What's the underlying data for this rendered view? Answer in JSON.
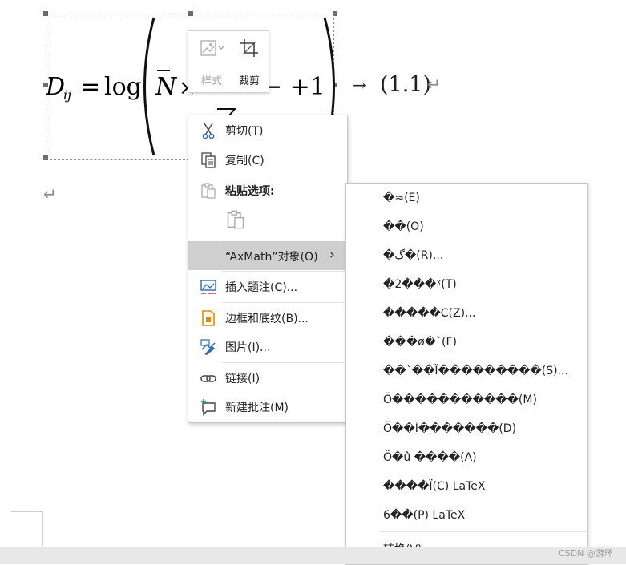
{
  "document": {
    "equation_number": "(1.1)",
    "arrow": "→",
    "paragraph_mark": "↵"
  },
  "mini_toolbar": {
    "style_label": "样式",
    "crop_label": "裁剪"
  },
  "context_menu": {
    "items": [
      {
        "label": "剪切(T)",
        "icon": "scissors-icon"
      },
      {
        "label": "复制(C)",
        "icon": "copy-icon"
      },
      {
        "label": "粘贴选项:",
        "icon": "paste-icon"
      },
      {
        "label": "“AxMath”对象(O)",
        "icon": "",
        "submenu_arrow": "›"
      },
      {
        "label": "插入题注(C)...",
        "icon": "insert-caption-icon"
      },
      {
        "label": "边框和底纹(B)...",
        "icon": "borders-shading-icon"
      },
      {
        "label": "图片(I)...",
        "icon": "picture-format-icon"
      },
      {
        "label": "链接(I)",
        "icon": "link-icon"
      },
      {
        "label": "新建批注(M)",
        "icon": "new-comment-icon"
      }
    ]
  },
  "submenu": {
    "items": [
      {
        "label": "�≈(E)"
      },
      {
        "label": "��(O)"
      },
      {
        "label": "�گ�(R)..."
      },
      {
        "label": "�2���ˠ(T)"
      },
      {
        "label": "�����C(Z)..."
      },
      {
        "label": "���ø�`(F)"
      },
      {
        "label": "��`��Ï���������(S)..."
      },
      {
        "label": "Ö�����������(M)"
      },
      {
        "label": "Ö��Ĭ�������(D)"
      },
      {
        "label": "Ö�û    ����(A)"
      },
      {
        "label": "����Ï(C) LaTeX"
      },
      {
        "label": "6��(P) LaTeX"
      },
      {
        "label": "转换(V)..."
      }
    ]
  },
  "watermark": "CSDN @游环"
}
